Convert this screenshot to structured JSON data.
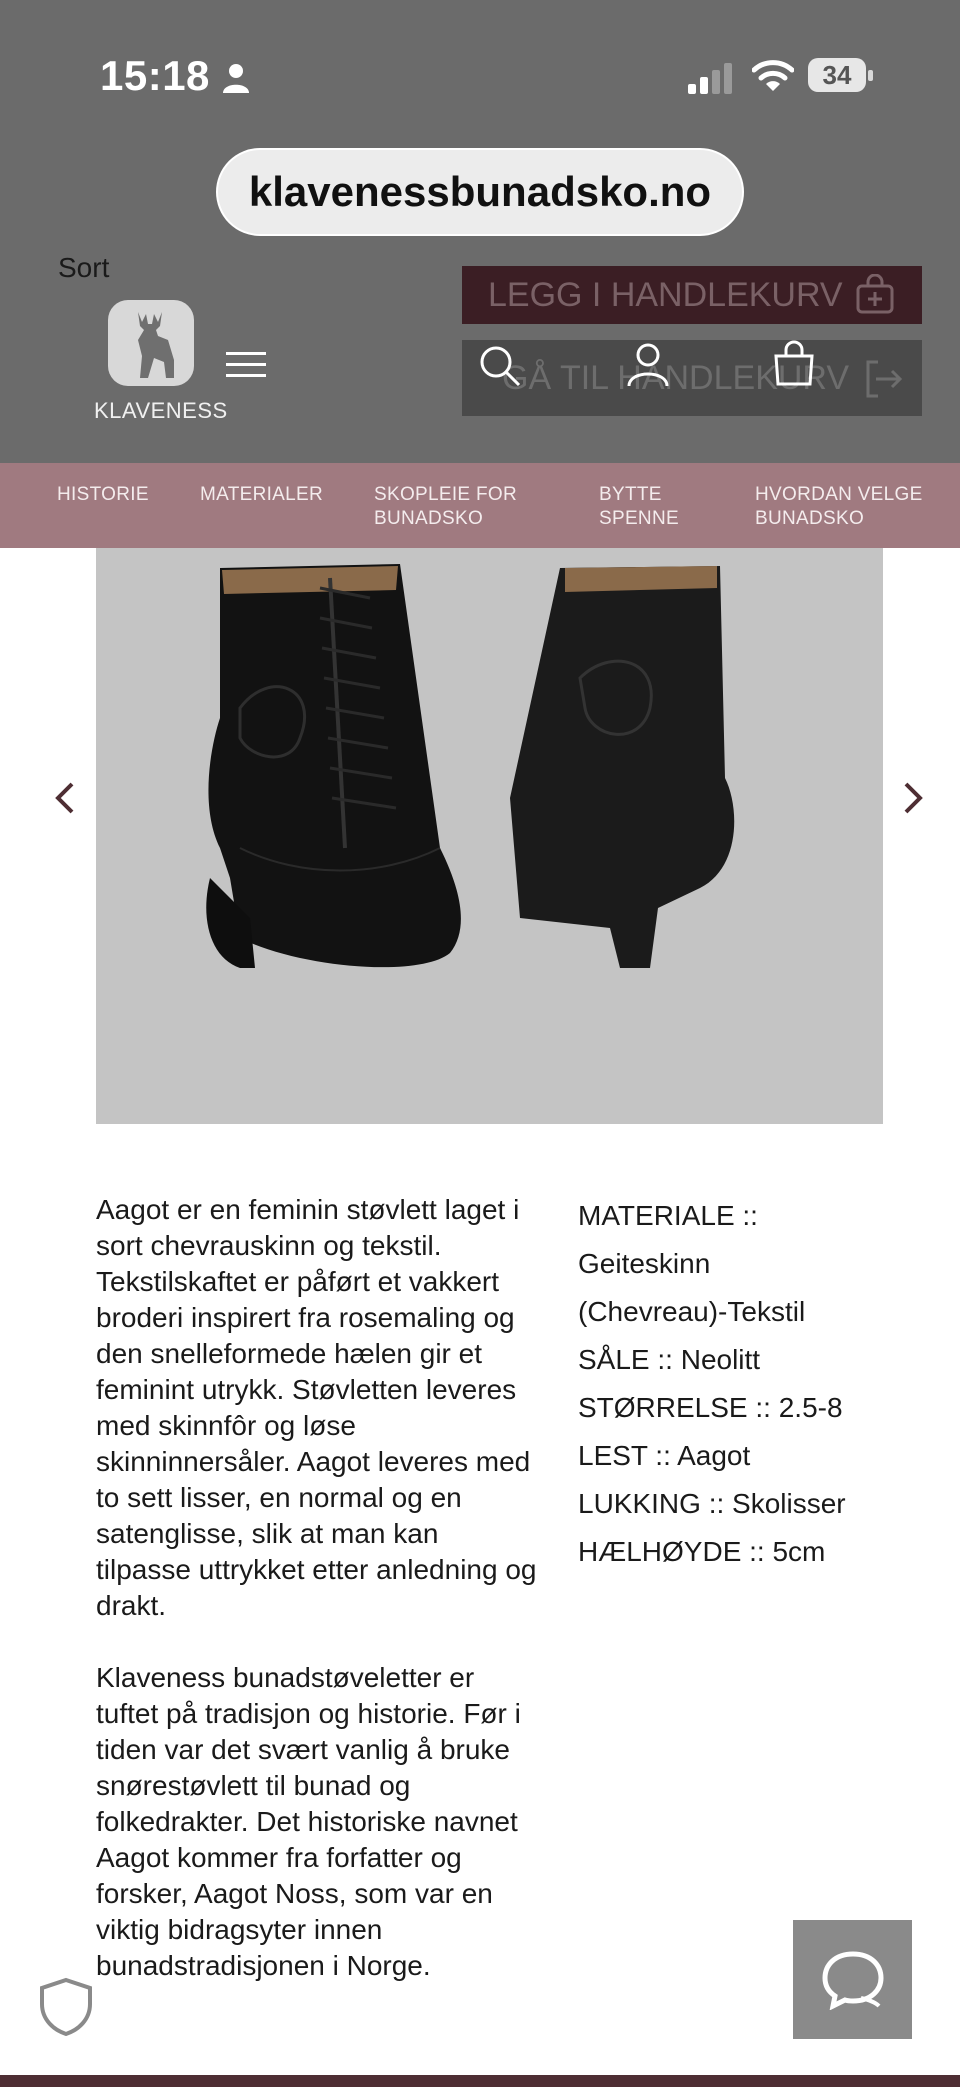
{
  "status_bar": {
    "time": "15:18",
    "battery": "34"
  },
  "browser": {
    "url": "klavenessbunadsko.no"
  },
  "product_options": {
    "color_label": "Sort"
  },
  "buttons": {
    "add_to_cart": "LEGG I HANDLEKURV",
    "go_to_cart": "GÅ TIL HANDLEKURV"
  },
  "header": {
    "logo_text": "KLAVENESS"
  },
  "nav": {
    "items": [
      {
        "label": "HISTORIE"
      },
      {
        "label": "MATERIALER"
      },
      {
        "label": "SKOPLEIE FOR BUNADSKO"
      },
      {
        "label": "BYTTE SPENNE"
      },
      {
        "label": "HVORDAN VELGE BUNADSKO"
      }
    ]
  },
  "description": {
    "paragraphs": [
      "Aagot er en feminin støvlett laget i sort chevrauskinn og tekstil. Tekstilskaftet er påført et vakkert broderi inspirert fra rosemaling og den snelleformede hælen gir et feminint utrykk.  Støvletten leveres med skinnfôr og løse skinninnersåler. Aagot leveres med to sett lisser, en normal og en satenglisse, slik at man kan tilpasse uttrykket etter anledning og drakt.",
      "Klaveness bunadstøveletter er tuftet på tradisjon og historie. Før i tiden var det svært vanlig å bruke snørestøvlett til bunad og folkedrakter. Det historiske navnet Aagot kommer fra forfatter og forsker, Aagot Noss, som var en viktig bidragsyter innen bunadstradisjonen i Norge."
    ]
  },
  "specs": {
    "lines": [
      "MATERIALE ::",
      "Geiteskinn",
      "(Chevreau)-Tekstil",
      "SÅLE :: Neolitt",
      "STØRRELSE :: 2.5-8",
      "LEST :: Aagot",
      "LUKKING :: Skolisser",
      "HÆLHØYDE :: 5cm"
    ]
  },
  "colors": {
    "brand": "#4e2e33",
    "nav_bg": "#a07a80",
    "overlay": "#6b6b6b",
    "chat_bg": "#8a8a8a"
  },
  "icons": [
    "person-icon",
    "signal-icon",
    "wifi-icon",
    "battery-icon",
    "cart-plus-icon",
    "exit-icon",
    "deer-logo",
    "menu-icon",
    "search-icon",
    "user-icon",
    "bag-icon",
    "chevron-left-icon",
    "chevron-right-icon",
    "shield-icon",
    "chat-icon"
  ]
}
